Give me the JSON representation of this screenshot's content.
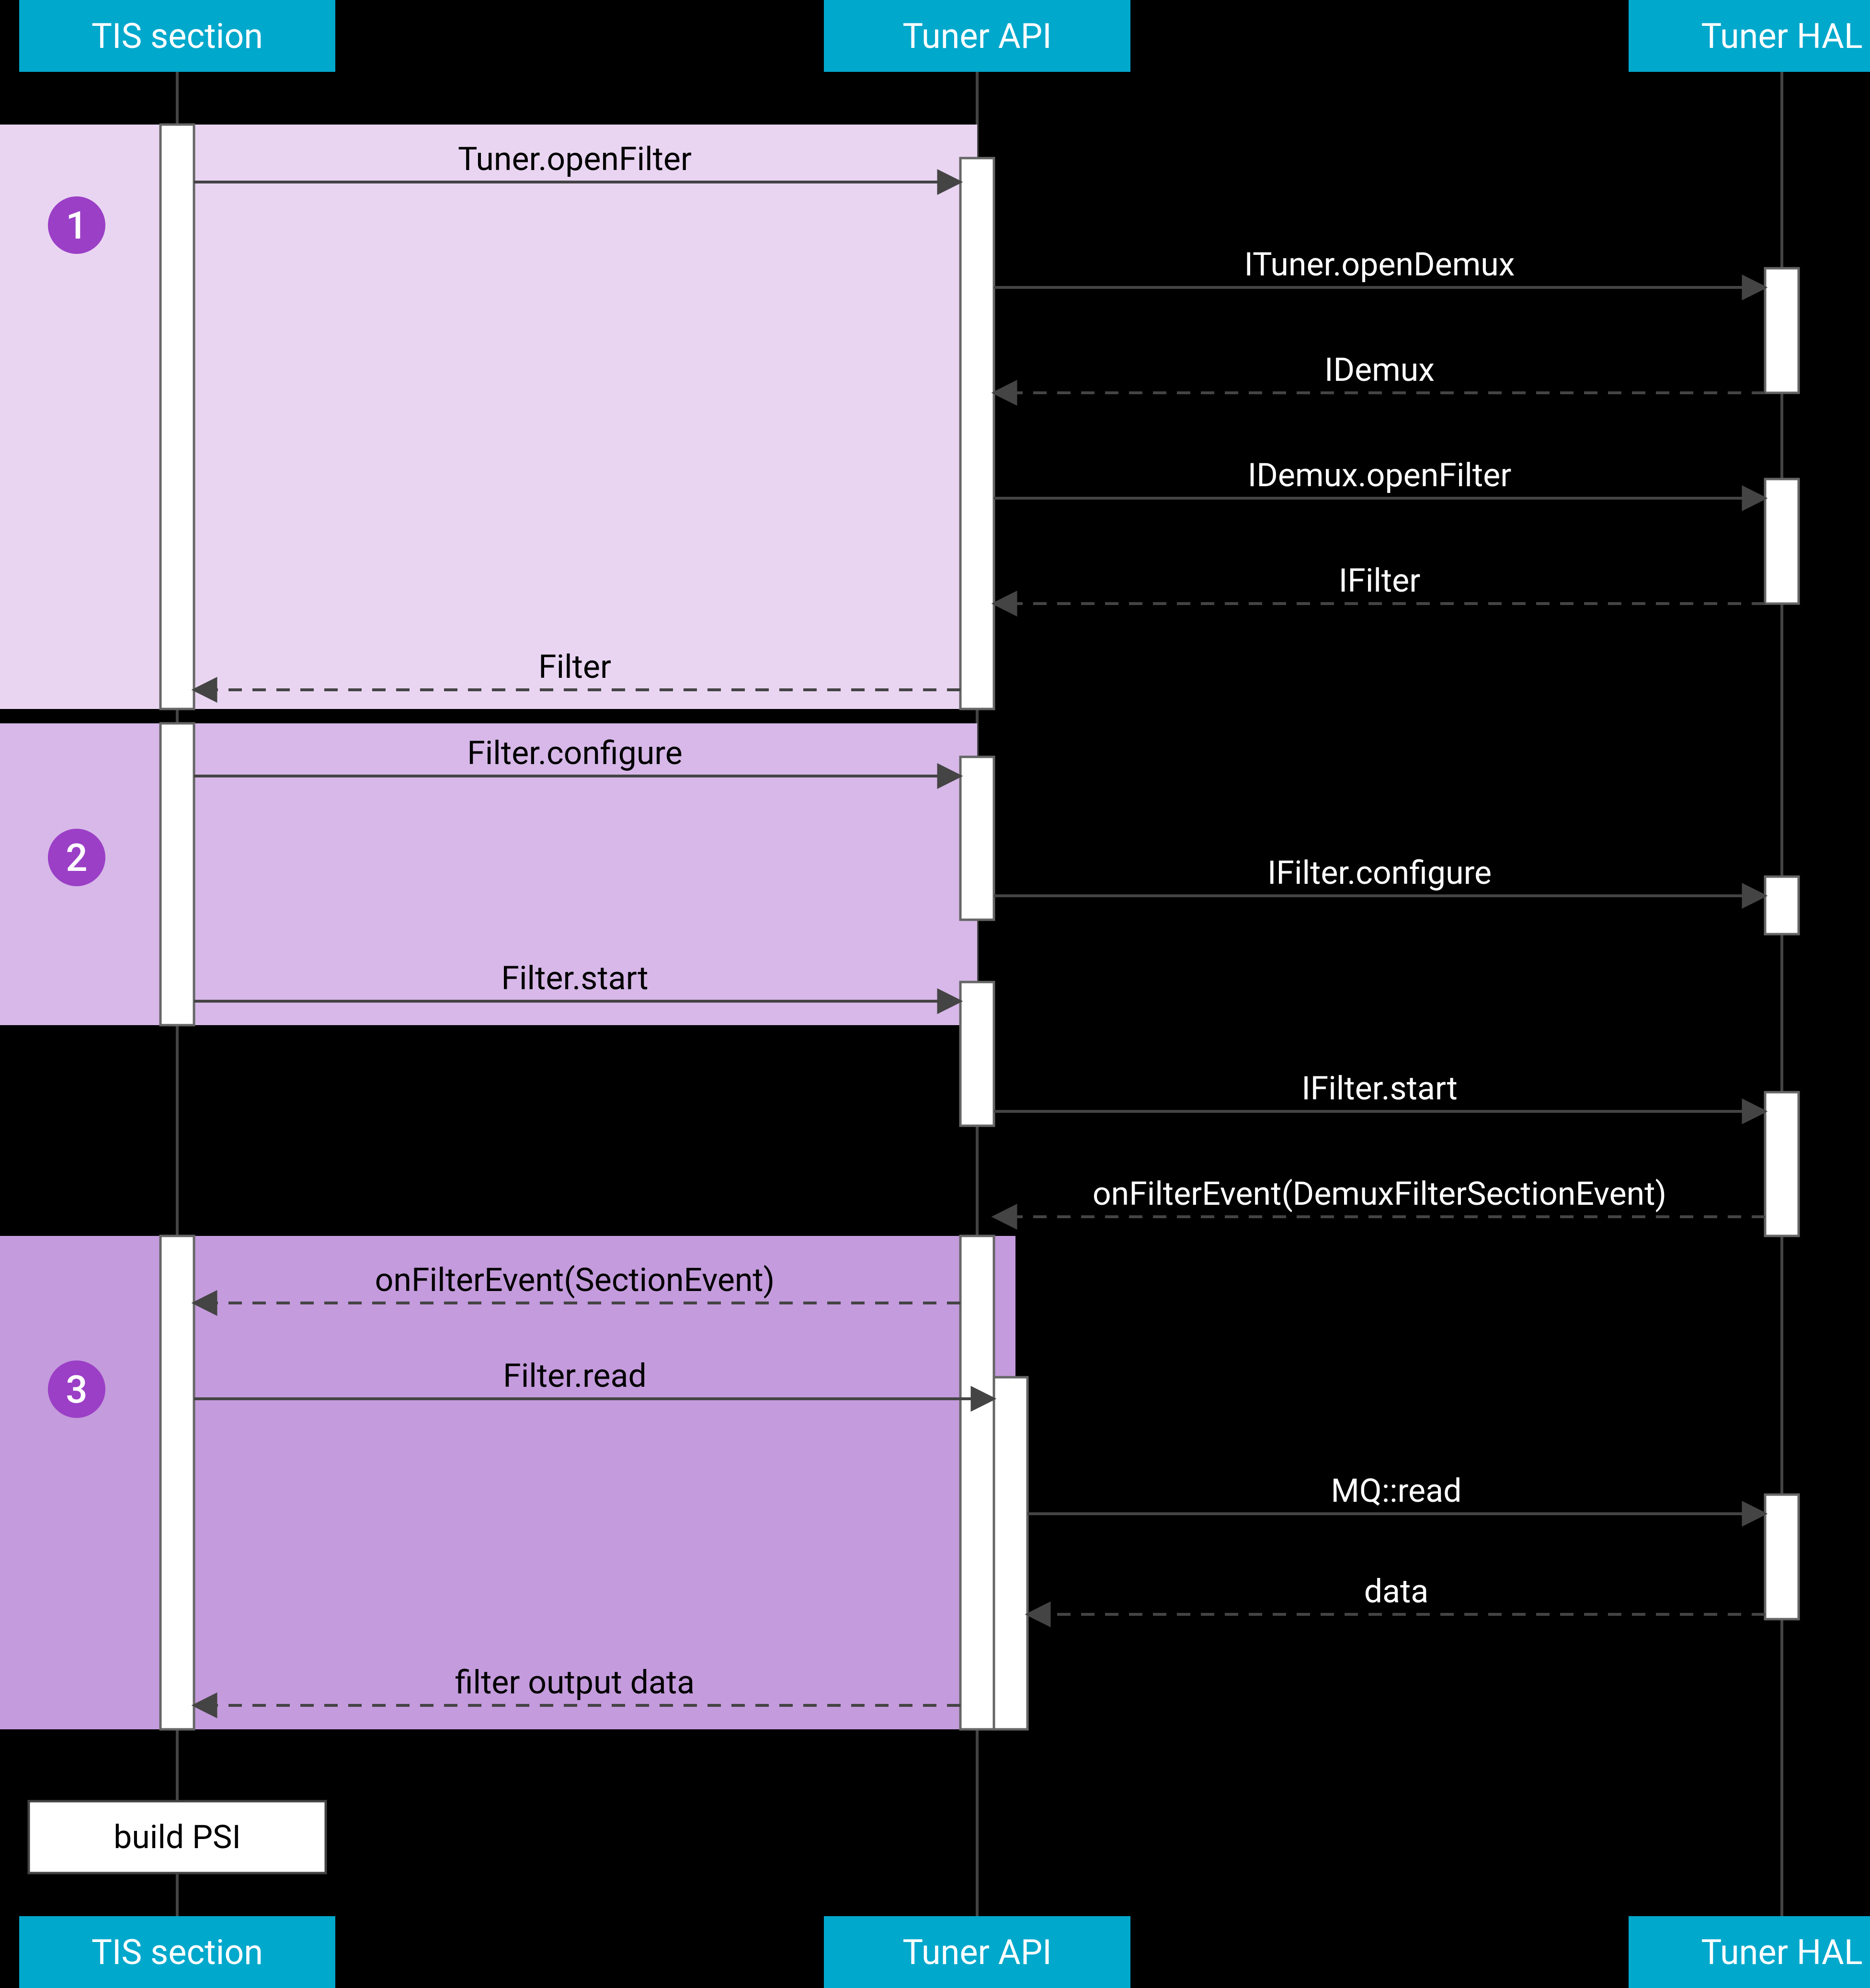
{
  "lanes": {
    "tis": {
      "label": "TIS section"
    },
    "api": {
      "label": "Tuner API"
    },
    "hal": {
      "label": "Tuner HAL"
    }
  },
  "steps": {
    "s1": "1",
    "s2": "2",
    "s3": "3"
  },
  "messages": {
    "openFilter": "Tuner.openFilter",
    "openFilterI": "ITuner.openDemux",
    "iDemux": "IDemux",
    "demuxOpenFilter": "IDemux.openFilter",
    "iFilter": "IFilter",
    "filterReturn": "Filter",
    "filterConfigure": "Filter.configure",
    "iFilterConfigure": "IFilter.configure",
    "filterStart": "Filter.start",
    "iFilterStart": "IFilter.start",
    "onFilterEventHAL": "onFilterEvent(DemuxFilterSectionEvent)",
    "onFilterEvent": "onFilterEvent(SectionEvent)",
    "filterRead": "Filter.read",
    "mqRead": "MQ::read",
    "mqData": "data",
    "filterOutput": "filter output data"
  },
  "note": {
    "buildPsi": "build PSI"
  }
}
